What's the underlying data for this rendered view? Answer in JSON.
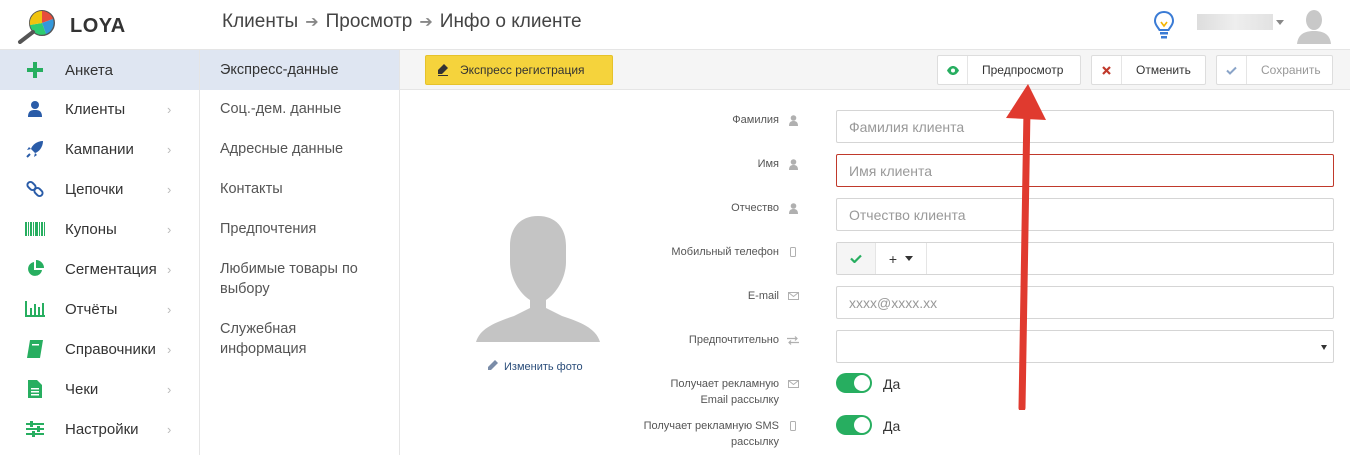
{
  "app": {
    "logo_text": "LOYA"
  },
  "breadcrumb": [
    "Клиенты",
    "Просмотр",
    "Инфо о клиенте"
  ],
  "sidebar": {
    "items": [
      {
        "label": "Анкета",
        "icon": "plus-icon",
        "active": true
      },
      {
        "label": "Клиенты",
        "icon": "user-icon"
      },
      {
        "label": "Кампании",
        "icon": "rocket-icon"
      },
      {
        "label": "Цепочки",
        "icon": "chain-icon"
      },
      {
        "label": "Купоны",
        "icon": "barcode-icon"
      },
      {
        "label": "Сегментация",
        "icon": "pie-icon"
      },
      {
        "label": "Отчёты",
        "icon": "bar-chart-icon"
      },
      {
        "label": "Справочники",
        "icon": "book-icon"
      },
      {
        "label": "Чеки",
        "icon": "receipt-icon"
      },
      {
        "label": "Настройки",
        "icon": "sliders-icon"
      }
    ]
  },
  "subnav": {
    "items": [
      "Экспресс-данные",
      "Соц.-дем. данные",
      "Адресные данные",
      "Контакты",
      "Предпочтения",
      "Любимые товары по",
      "выбору",
      "Служебная",
      "информация"
    ]
  },
  "toolbar": {
    "express_label": "Экспресс регистрация",
    "preview_label": "Предпросмотр",
    "cancel_label": "Отменить",
    "save_label": "Сохранить"
  },
  "photo": {
    "change_label": "Изменить фото"
  },
  "form": {
    "surname_label": "Фамилия",
    "surname_placeholder": "Фамилия клиента",
    "name_label": "Имя",
    "name_placeholder": "Имя клиента",
    "patronymic_label": "Отчество",
    "patronymic_placeholder": "Отчество клиента",
    "phone_label": "Мобильный телефон",
    "phone_code": "+",
    "email_label": "E-mail",
    "email_placeholder": "xxxx@xxxx.xx",
    "preferred_label": "Предпочтительно",
    "email_ads_label_1": "Получает рекламную",
    "email_ads_label_2": "Email рассылку",
    "email_ads_value": "Да",
    "sms_ads_label_1": "Получает рекламную SMS",
    "sms_ads_label_2": "рассылку",
    "sms_ads_value": "Да"
  },
  "colors": {
    "accent_yellow": "#f5d33c",
    "toggle_green": "#27ae60",
    "error_red": "#c0392b",
    "annotation_red": "#e03a2f"
  }
}
